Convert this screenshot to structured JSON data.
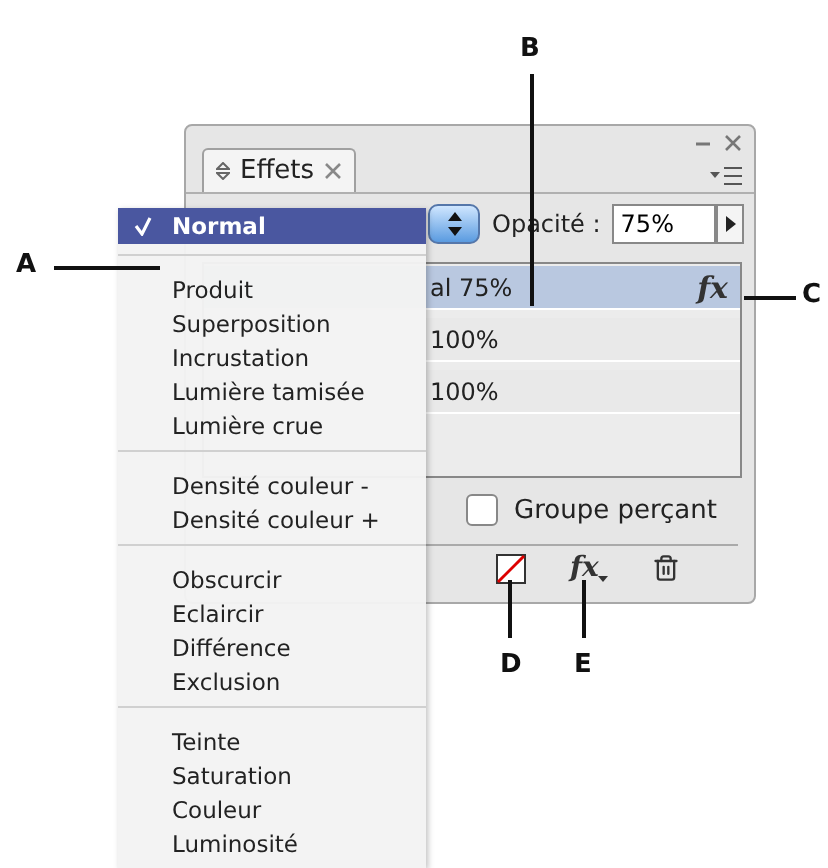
{
  "panel": {
    "tab": {
      "title": "Effets"
    },
    "opacity": {
      "label": "Opacité :",
      "value": "75%"
    },
    "rows": [
      {
        "text": "al 75%",
        "selected": true,
        "fx": "fx"
      },
      {
        "text": "100%",
        "selected": false
      },
      {
        "text": "100%",
        "selected": false
      }
    ],
    "knockout_group": {
      "label": "Groupe perçant",
      "checked": false
    },
    "footer_fx": "fx"
  },
  "blend_menu": {
    "groups": [
      [
        {
          "label": "Normal",
          "selected": true
        }
      ],
      [
        {
          "label": "Produit",
          "selected": false
        },
        {
          "label": "Superposition",
          "selected": false
        },
        {
          "label": "Incrustation",
          "selected": false
        },
        {
          "label": "Lumière tamisée",
          "selected": false
        },
        {
          "label": "Lumière crue",
          "selected": false
        }
      ],
      [
        {
          "label": "Densité couleur -",
          "selected": false
        },
        {
          "label": "Densité couleur +",
          "selected": false
        }
      ],
      [
        {
          "label": "Obscurcir",
          "selected": false
        },
        {
          "label": "Eclaircir",
          "selected": false
        },
        {
          "label": "Différence",
          "selected": false
        },
        {
          "label": "Exclusion",
          "selected": false
        }
      ],
      [
        {
          "label": "Teinte",
          "selected": false
        },
        {
          "label": "Saturation",
          "selected": false
        },
        {
          "label": "Couleur",
          "selected": false
        },
        {
          "label": "Luminosité",
          "selected": false
        }
      ]
    ]
  },
  "callouts": [
    {
      "label": "A"
    },
    {
      "label": "B"
    },
    {
      "label": "C"
    },
    {
      "label": "D"
    },
    {
      "label": "E"
    }
  ]
}
